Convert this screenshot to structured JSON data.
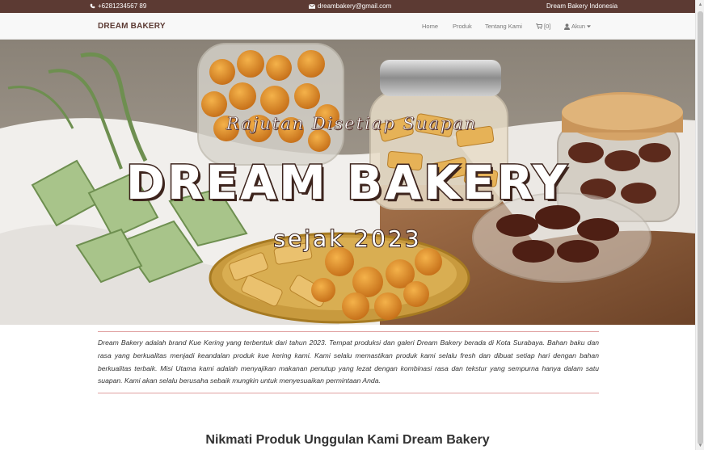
{
  "topbar": {
    "phone": "+6281234567 89",
    "email": "dreambakery@gmail.com",
    "brand": "Dream Bakery Indonesia"
  },
  "navbar": {
    "brand": "DREAM BAKERY",
    "links": [
      "Home",
      "Produk",
      "Tentang Kami"
    ],
    "cart": "[0]",
    "account": "Akun"
  },
  "hero": {
    "tagline": "Rajutan Disetiap Suapan",
    "title": "DREAM BAKERY",
    "since": "sejak 2023"
  },
  "about": {
    "text": "Dream Bakery adalah brand Kue Kering yang terbentuk dari tahun 2023. Tempat produksi dan galeri Dream Bakery berada di Kota Surabaya. Bahan baku dan rasa yang berkualitas menjadi keandalan produk kue kering kami. Kami selalu memastikan produk kami selalu fresh dan dibuat setiap hari dengan bahan berkualitas terbaik. Misi Utama kami adalah menyajikan makanan penutup yang lezat dengan kombinasi rasa dan tekstur yang sempurna hanya dalam satu suapan. Kami akan selalu berusaha sebaik mungkin untuk menyesuaikan permintaan Anda."
  },
  "section": {
    "title": "Nikmati Produk Unggulan Kami Dream Bakery"
  },
  "icons": {
    "phone": "phone-icon",
    "email": "envelope-icon",
    "cart": "cart-icon",
    "user": "user-icon",
    "caret": "caret-down-icon"
  },
  "colors": {
    "topbar": "#5c3a33",
    "brand_text": "#5c3a33",
    "divider": "#e0a0a0"
  }
}
